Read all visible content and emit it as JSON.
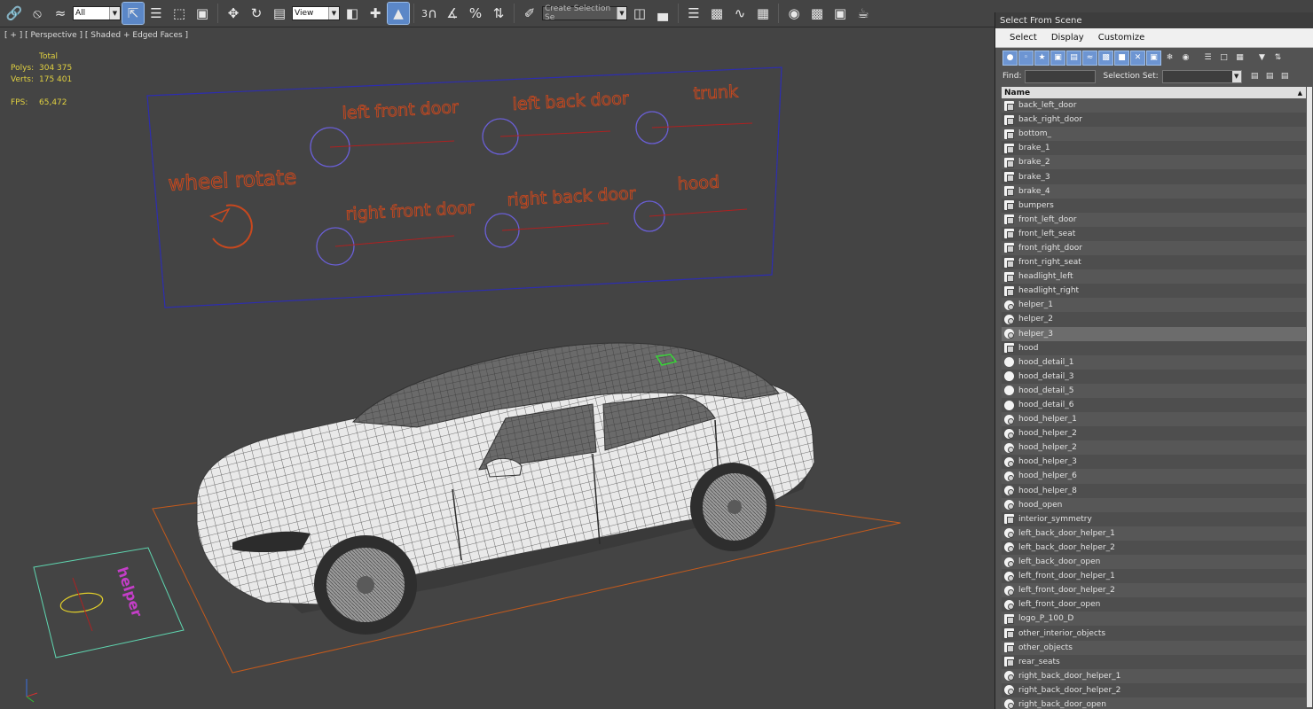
{
  "toolbar": {
    "filter_value": "All",
    "coord_value": "View",
    "selection_set_placeholder": "Create Selection Se",
    "snaps_label": "3"
  },
  "viewport": {
    "label": "[ + ] [ Perspective ] [ Shaded + Edged Faces ]",
    "stats": {
      "header": "Total",
      "polys_label": "Polys:",
      "polys_value": "304 375",
      "verts_label": "Verts:",
      "verts_value": "175 401",
      "fps_label": "FPS:",
      "fps_value": "65,472"
    },
    "control_labels": {
      "wheel_rotate": "wheel rotate",
      "left_front_door": "left front door",
      "left_back_door": "left back door",
      "trunk": "trunk",
      "right_front_door": "right front door",
      "right_back_door": "right back door",
      "hood": "hood",
      "helper_text": "helper"
    },
    "colors": {
      "label": "#c8481e",
      "frame": "#2d2db0",
      "circle": "#6a5fd6",
      "ground": "#c45a1c",
      "helper_frame": "#5fd6b0",
      "helper_text": "#c43ec8",
      "helper_ellipse": "#e2cf2a"
    }
  },
  "panel": {
    "title": "Select From Scene",
    "menu": [
      "Select",
      "Display",
      "Customize"
    ],
    "find_label": "Find:",
    "selection_set_label": "Selection Set:",
    "column_header": "Name",
    "items": [
      {
        "name": "back_left_door",
        "kind": "mesh"
      },
      {
        "name": "back_right_door",
        "kind": "mesh"
      },
      {
        "name": "bottom_",
        "kind": "mesh"
      },
      {
        "name": "brake_1",
        "kind": "mesh"
      },
      {
        "name": "brake_2",
        "kind": "mesh"
      },
      {
        "name": "brake_3",
        "kind": "mesh"
      },
      {
        "name": "brake_4",
        "kind": "mesh"
      },
      {
        "name": "bumpers",
        "kind": "mesh"
      },
      {
        "name": "front_left_door",
        "kind": "mesh"
      },
      {
        "name": "front_left_seat",
        "kind": "mesh"
      },
      {
        "name": "front_right_door",
        "kind": "mesh"
      },
      {
        "name": "front_right_seat",
        "kind": "mesh"
      },
      {
        "name": "headlight_left",
        "kind": "mesh"
      },
      {
        "name": "headlight_right",
        "kind": "mesh"
      },
      {
        "name": "helper_1",
        "kind": "helper"
      },
      {
        "name": "helper_2",
        "kind": "helper"
      },
      {
        "name": "helper_3",
        "kind": "helper",
        "selected": true
      },
      {
        "name": "hood",
        "kind": "mesh"
      },
      {
        "name": "hood_detail_1",
        "kind": "sphere"
      },
      {
        "name": "hood_detail_3",
        "kind": "sphere"
      },
      {
        "name": "hood_detail_5",
        "kind": "sphere"
      },
      {
        "name": "hood_detail_6",
        "kind": "sphere"
      },
      {
        "name": "hood_helper_1",
        "kind": "helper"
      },
      {
        "name": "hood_helper_2",
        "kind": "helper"
      },
      {
        "name": "hood_helper_2",
        "kind": "helper"
      },
      {
        "name": "hood_helper_3",
        "kind": "helper"
      },
      {
        "name": "hood_helper_6",
        "kind": "helper"
      },
      {
        "name": "hood_helper_8",
        "kind": "helper"
      },
      {
        "name": "hood_open",
        "kind": "helper"
      },
      {
        "name": "interior_symmetry",
        "kind": "mesh"
      },
      {
        "name": "left_back_door_helper_1",
        "kind": "helper"
      },
      {
        "name": "left_back_door_helper_2",
        "kind": "helper"
      },
      {
        "name": "left_back_door_open",
        "kind": "helper"
      },
      {
        "name": "left_front_door_helper_1",
        "kind": "helper"
      },
      {
        "name": "left_front_door_helper_2",
        "kind": "helper"
      },
      {
        "name": "left_front_door_open",
        "kind": "helper"
      },
      {
        "name": "logo_P_100_D",
        "kind": "mesh"
      },
      {
        "name": "other_interior_objects",
        "kind": "mesh"
      },
      {
        "name": "other_objects",
        "kind": "mesh"
      },
      {
        "name": "rear_seats",
        "kind": "mesh"
      },
      {
        "name": "right_back_door_helper_1",
        "kind": "helper"
      },
      {
        "name": "right_back_door_helper_2",
        "kind": "helper"
      },
      {
        "name": "right_back_door_open",
        "kind": "helper"
      }
    ]
  }
}
